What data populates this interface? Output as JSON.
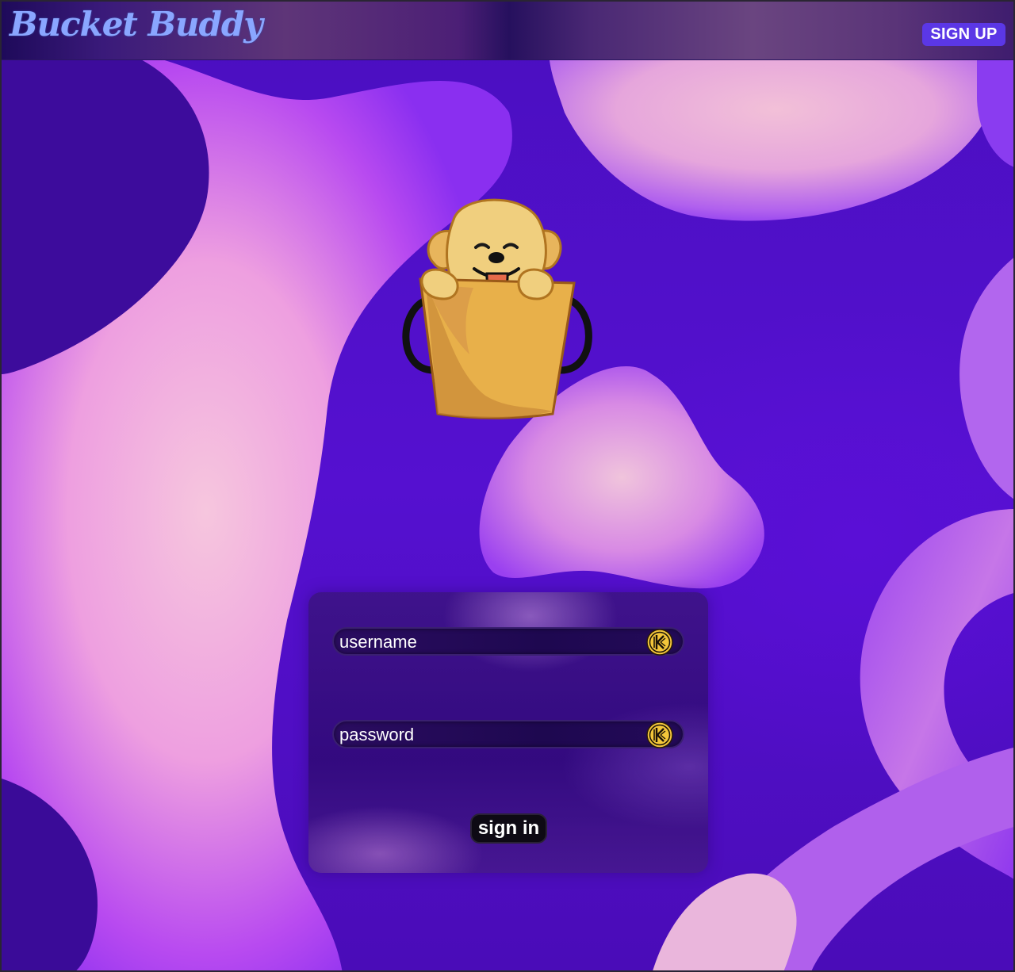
{
  "header": {
    "logo_text": "Bucket Buddy",
    "signup_label": "SIGN UP"
  },
  "login": {
    "username_placeholder": "username",
    "password_placeholder": "password",
    "signin_label": "sign in"
  },
  "icons": {
    "mascot": "dog-in-bucket-icon",
    "password_manager": "keeper-icon"
  },
  "colors": {
    "accent": "#5b37e6",
    "logo": "#8aa6ff",
    "background": "#4a0fc0",
    "blob": "#f0c0e0"
  }
}
